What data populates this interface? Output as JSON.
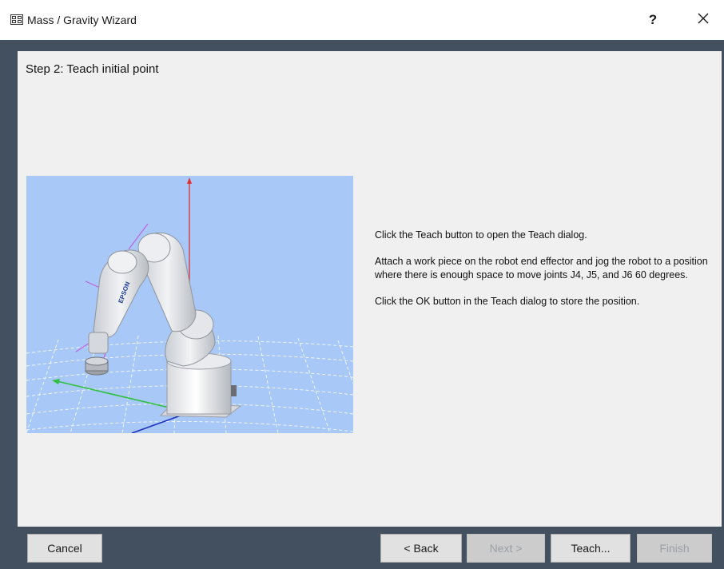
{
  "window": {
    "title": "Mass / Gravity Wizard",
    "help_label": "?",
    "app_icon": "wizard-app-icon",
    "close_icon": "close-icon"
  },
  "step": {
    "title": "Step 2: Teach initial point"
  },
  "image": {
    "subject": "robot-arm-3d-view",
    "background_color": "#a8c8f8",
    "robot_label": "EPSON"
  },
  "instructions": [
    "Click the Teach button to open the Teach dialog.",
    "Attach a work piece on the robot end effector and jog the robot to a position where there is enough space to move joints J4, J5, and J6 60 degrees.",
    "Click the OK button in the Teach dialog to store the position."
  ],
  "buttons": {
    "cancel": "Cancel",
    "back": "< Back",
    "next": "Next >",
    "teach": "Teach...",
    "finish": "Finish"
  },
  "colors": {
    "window_frame": "#42505f",
    "client_bg": "#f0f0f0",
    "button_bg": "#e1e1e1",
    "button_disabled_bg": "#cccccc",
    "axis_z": "#e03030",
    "axis_y": "#30c040",
    "axis_x": "#2030c0"
  }
}
